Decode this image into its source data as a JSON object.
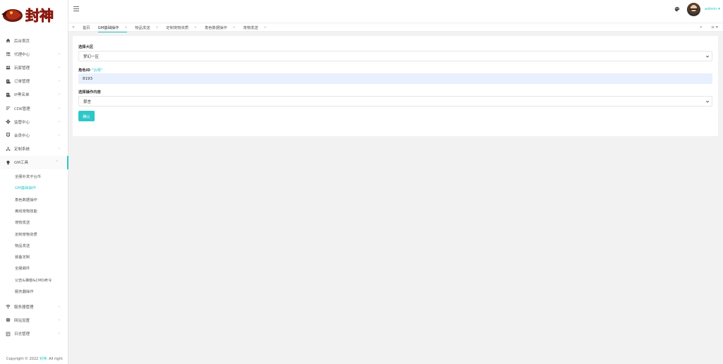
{
  "logo": {
    "text": "封神"
  },
  "sidebar": {
    "items": [
      {
        "label": "后台首页",
        "icon": "home-icon"
      },
      {
        "label": "代理中心",
        "icon": "agents-icon",
        "arrow": "›"
      },
      {
        "label": "玩家管理",
        "icon": "users-icon",
        "arrow": "›"
      },
      {
        "label": "订单管理",
        "icon": "order-icon",
        "arrow": "›"
      },
      {
        "label": "IP黑名单",
        "icon": "blacklist-icon",
        "arrow": "›"
      },
      {
        "label": "CDK管理",
        "icon": "cdk-icon",
        "arrow": "›"
      },
      {
        "label": "监管中心",
        "icon": "gear-icon",
        "arrow": "›"
      },
      {
        "label": "会员中心",
        "icon": "member-icon",
        "arrow": "›"
      },
      {
        "label": "定制系统",
        "icon": "custom-icon",
        "arrow": "›"
      },
      {
        "label": "GM工具",
        "icon": "bulb-icon",
        "arrow": "⌃"
      }
    ],
    "submenu": [
      "全服补发平台币",
      "GM基础操作",
      "角色数据操作",
      "离线宠物技能",
      "宠物发送",
      "定制宠物资质",
      "物品发送",
      "装备定制",
      "全服邮件",
      "公告&弹窗&CMD命令",
      "服务器操作"
    ],
    "bottom_items": [
      {
        "label": "服务器管理",
        "icon": "wifi-icon",
        "arrow": "›"
      },
      {
        "label": "网站设置",
        "icon": "globe-icon",
        "arrow": "›"
      },
      {
        "label": "日志管理",
        "icon": "log-icon",
        "arrow": "›"
      }
    ],
    "copyright_prefix": "Copyright © 2022",
    "copyright_brand": "封神",
    "copyright_suffix": ". All right"
  },
  "header": {
    "username": "admin ▾",
    "hamburger": "menu-icon",
    "theme": "palette-icon"
  },
  "tabs": {
    "prev": "«",
    "next": "»",
    "menu": "≡ ▾",
    "items": [
      {
        "label": "首页",
        "close": ""
      },
      {
        "label": "GM基础操作",
        "close": "×"
      },
      {
        "label": "物品发送",
        "close": "×"
      },
      {
        "label": "定制宠物资质",
        "close": "×"
      },
      {
        "label": "角色数据操作",
        "close": "×"
      },
      {
        "label": "宠物发送",
        "close": "×"
      }
    ]
  },
  "form": {
    "region_label": "选择大区",
    "region_value": "梦幻一区",
    "role_label": "角色ID",
    "role_note": "\"云缨\"",
    "role_value": "8193",
    "op_label": "选择操作内容",
    "op_value": "禁言",
    "submit_label": "确认"
  },
  "colors": {
    "accent": "#2ec7c9",
    "input_bg": "#e8f0fe",
    "page_bg": "#f2f2f2"
  }
}
